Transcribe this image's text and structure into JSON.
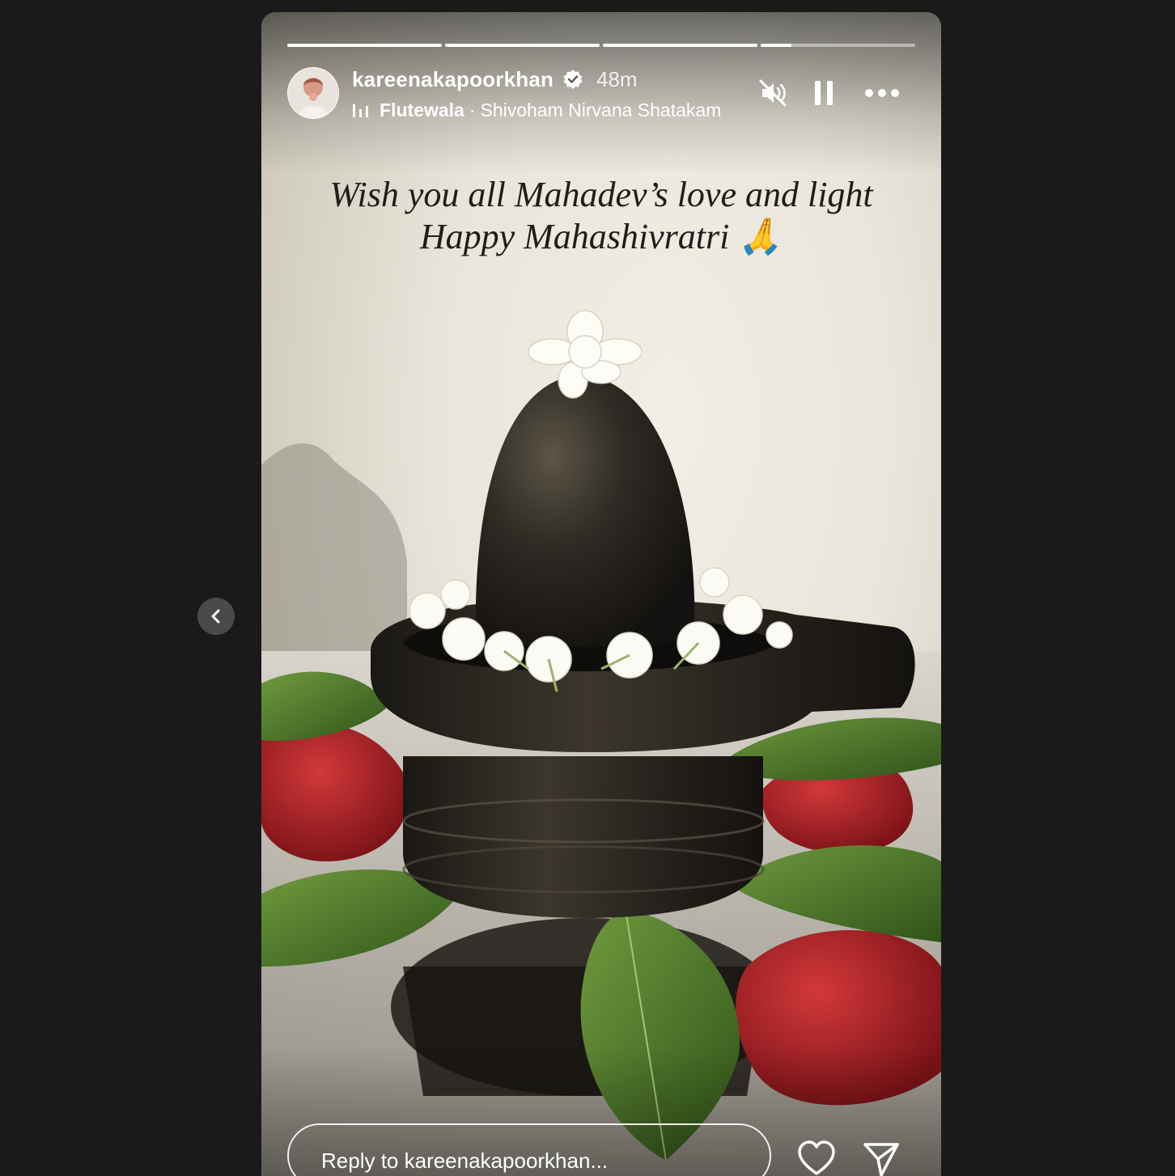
{
  "story": {
    "username": "kareenakapoorkhan",
    "time_ago": "48m",
    "verified": true,
    "music": {
      "artist": "Flutewala",
      "separator": "·",
      "track": "Shivoham Nirvana Shatakam"
    },
    "progress": [
      1,
      1,
      1,
      0.2
    ],
    "caption_line1": "Wish you all Mahadev’s love and light",
    "caption_line2": "Happy Mahashivratri 🙏",
    "reply_placeholder": "Reply to kareenakapoorkhan..."
  },
  "icons": {
    "mute": "speaker-muted-icon",
    "pause": "pause-icon",
    "more": "more-options-icon",
    "like": "heart-icon",
    "share": "send-icon",
    "previous": "chevron-left-icon",
    "verified": "verified-badge-icon",
    "music": "music-bars-icon"
  },
  "colors": {
    "page_background": "#1a1a1a",
    "progress_active": "#ffffff",
    "verified_badge": "#ffffff"
  }
}
